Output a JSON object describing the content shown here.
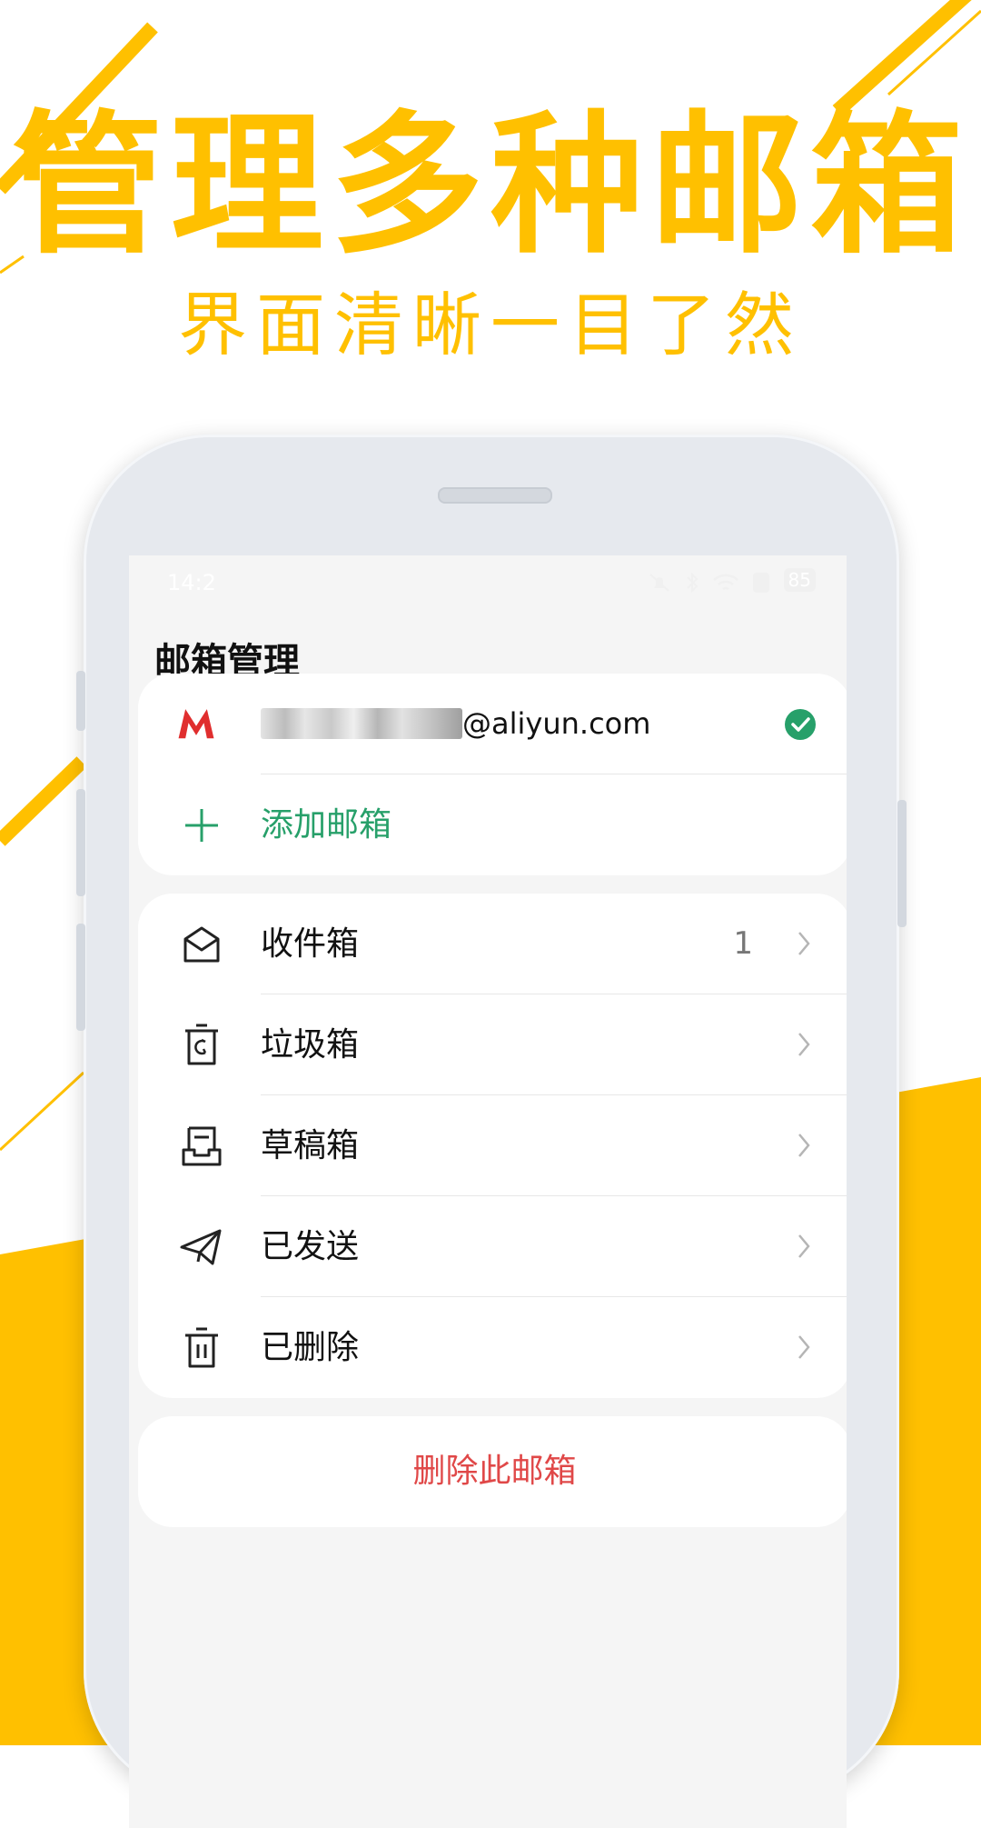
{
  "headline": "管理多种邮箱",
  "subheadline": "界面清晰一目了然",
  "colors": {
    "accent": "#FFC000",
    "green": "#27a06a",
    "red": "#e04848",
    "brand_m": "#e02e2e"
  },
  "status_bar": {
    "time": "14:2",
    "battery": "85"
  },
  "app": {
    "title": "邮箱管理",
    "account": {
      "icon": "mail-m-logo-icon",
      "email_suffix": "@aliyun.com",
      "selected_icon": "check-circle-icon"
    },
    "add_mailbox": {
      "icon": "plus-icon",
      "label": "添加邮箱"
    },
    "folders": [
      {
        "icon": "envelope-open-icon",
        "label": "收件箱",
        "count": "1"
      },
      {
        "icon": "trash-recycle-icon",
        "label": "垃圾箱",
        "count": ""
      },
      {
        "icon": "draft-tray-icon",
        "label": "草稿箱",
        "count": ""
      },
      {
        "icon": "paper-plane-icon",
        "label": "已发送",
        "count": ""
      },
      {
        "icon": "trash-can-icon",
        "label": "已删除",
        "count": ""
      }
    ],
    "delete_mailbox_label": "删除此邮箱"
  }
}
